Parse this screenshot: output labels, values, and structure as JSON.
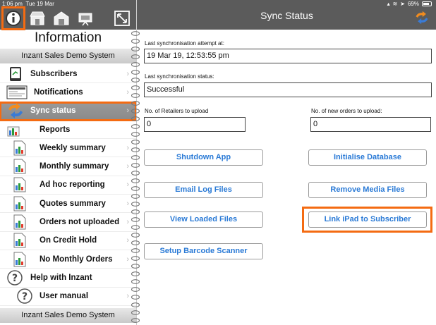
{
  "status_bar": {
    "time": "1:06 pm",
    "date": "Tue 19 Mar",
    "battery": "69%"
  },
  "left_panel": {
    "toolbar": {
      "buttons": [
        {
          "name": "info-icon",
          "selected": true
        },
        {
          "name": "store-icon",
          "selected": false
        },
        {
          "name": "warehouse-icon",
          "selected": false
        },
        {
          "name": "presentation-icon",
          "selected": false
        },
        {
          "name": "resize-icon",
          "selected": false
        }
      ]
    },
    "title": "Information",
    "system_name_top": "Inzant Sales Demo System",
    "system_name_bottom": "Inzant Sales Demo System",
    "items": [
      {
        "label": "Subscribers",
        "icon": "tablet-icon",
        "active": false,
        "chevron": true
      },
      {
        "label": "Notifications",
        "icon": "notifications-icon",
        "active": false,
        "chevron": true
      },
      {
        "label": "Sync status",
        "icon": "sync-icon",
        "active": true,
        "chevron": true
      },
      {
        "label": "Reports",
        "icon": "report-icon",
        "active": false,
        "chevron": false
      },
      {
        "label": "Weekly summary",
        "icon": "report-doc-icon",
        "active": false,
        "chevron": true
      },
      {
        "label": "Monthly summary",
        "icon": "report-doc-icon",
        "active": false,
        "chevron": true
      },
      {
        "label": "Ad hoc reporting",
        "icon": "report-doc-icon",
        "active": false,
        "chevron": true
      },
      {
        "label": "Quotes summary",
        "icon": "report-doc-icon",
        "active": false,
        "chevron": true
      },
      {
        "label": "Orders not uploaded",
        "icon": "report-doc-icon",
        "active": false,
        "chevron": true
      },
      {
        "label": "On Credit Hold",
        "icon": "report-doc-icon",
        "active": false,
        "chevron": true
      },
      {
        "label": "No Monthly Orders",
        "icon": "report-doc-icon",
        "active": false,
        "chevron": true
      },
      {
        "label": "Help with Inzant",
        "icon": "help-icon",
        "active": false,
        "chevron": false
      },
      {
        "label": "User manual",
        "icon": "help-icon",
        "active": false,
        "chevron": true
      }
    ]
  },
  "right_panel": {
    "title": "Sync Status",
    "last_attempt_label": "Last synchronisation attempt at:",
    "last_attempt_value": "19 Mar 19, 12:53:55 pm",
    "last_status_label": "Last synchronisation status:",
    "last_status_value": "Successful",
    "retailers_label": "No. of Retailers to upload",
    "retailers_value": "0",
    "orders_label": "No. of new orders to upload:",
    "orders_value": "0",
    "buttons": {
      "shutdown": "Shutdown App",
      "initialise": "Initialise Database",
      "email_logs": "Email Log Files",
      "remove_media": "Remove Media Files",
      "view_loaded": "View Loaded Files",
      "link_ipad": "Link iPad to Subscriber",
      "barcode": "Setup Barcode Scanner"
    }
  },
  "colors": {
    "highlight": "#f46b12",
    "link_blue": "#2a7ad6",
    "header_gray": "#5b5b5b"
  }
}
